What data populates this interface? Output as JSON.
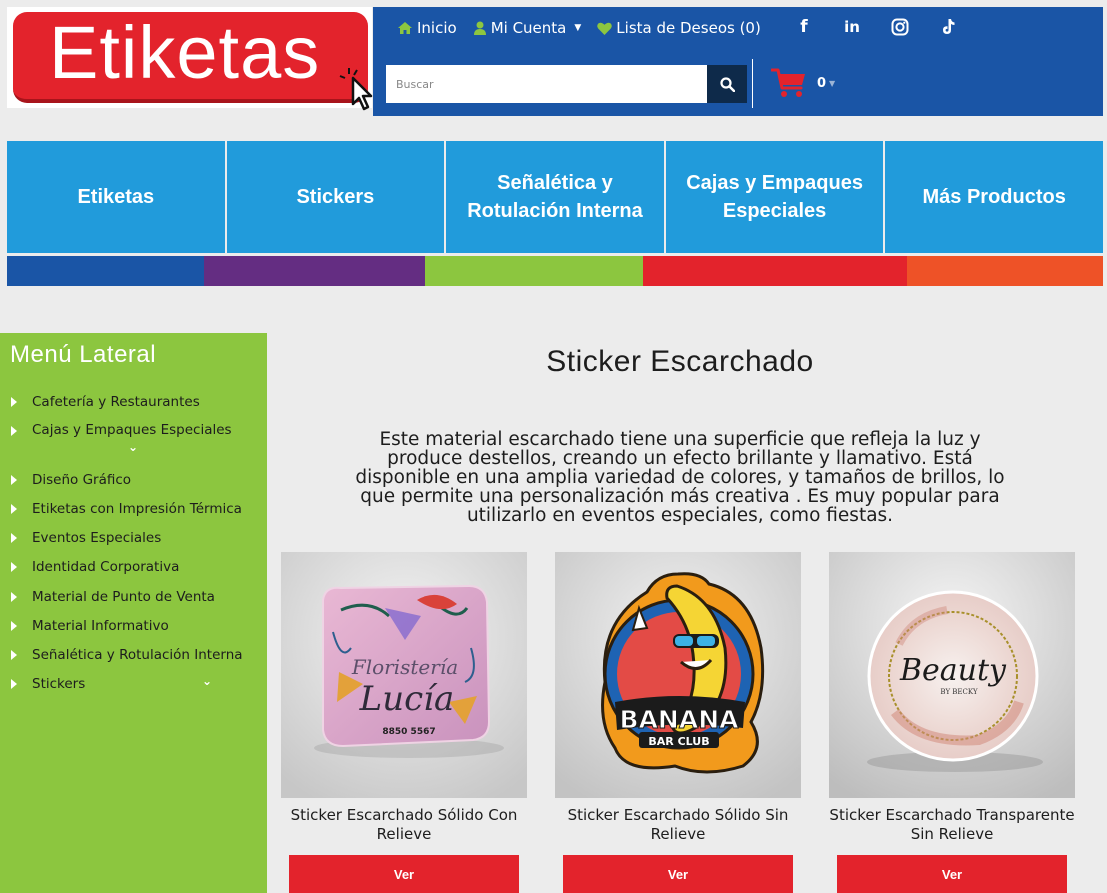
{
  "brand": {
    "logo_text": "Etiketas"
  },
  "header": {
    "links": [
      {
        "label": "Inicio",
        "icon": "home-icon"
      },
      {
        "label": "Mi Cuenta",
        "icon": "user-icon"
      },
      {
        "label": "Lista de Deseos (0)",
        "icon": "heart-icon"
      }
    ],
    "socials": [
      "facebook-icon",
      "linkedin-icon",
      "instagram-icon",
      "tiktok-icon"
    ],
    "search": {
      "placeholder": "Buscar"
    },
    "cart": {
      "count": "0"
    }
  },
  "nav": {
    "items": [
      {
        "label": "Etiketas"
      },
      {
        "label": "Stickers"
      },
      {
        "label": "Señalética y Rotulación Interna"
      },
      {
        "label": "Cajas y Empaques Especiales"
      },
      {
        "label": "Más Productos"
      }
    ],
    "strip_colors": [
      "#1a55a6",
      "#642d82",
      "#8cc63f",
      "#e3232c",
      "#ee5227"
    ]
  },
  "sidebar": {
    "title": "Menú Lateral",
    "items": [
      {
        "label": "Cafetería y Restaurantes"
      },
      {
        "label": "Cajas y Empaques Especiales"
      },
      {
        "label": "Diseño Gráfico"
      },
      {
        "label": "Etiketas con Impresión Térmica"
      },
      {
        "label": "Eventos Especiales"
      },
      {
        "label": "Identidad Corporativa"
      },
      {
        "label": "Material de Punto de Venta"
      },
      {
        "label": "Material Informativo"
      },
      {
        "label": "Señalética y Rotulación Interna"
      },
      {
        "label": "Stickers"
      }
    ]
  },
  "main": {
    "title": "Sticker Escarchado",
    "description": "Este material escarchado tiene una superficie que refleja la luz y produce destellos, creando un efecto brillante y llamativo. Está disponible en una amplia variedad de colores, y tamaños de brillos, lo que permite una personalización más creativa . Es muy popular para utilizarlo en eventos especiales, como fiestas.",
    "products": [
      {
        "name": "Sticker Escarchado Sólido Con Relieve",
        "button": "Ver",
        "img_text_1": "Floristería",
        "img_text_2": "Lucía",
        "img_text_3": "8850 5567"
      },
      {
        "name": "Sticker Escarchado Sólido Sin Relieve",
        "button": "Ver",
        "img_text_1": "BANANA",
        "img_text_2": "BAR CLUB"
      },
      {
        "name": "Sticker Escarchado Transparente Sin Relieve",
        "button": "Ver",
        "img_text_1": "Beauty",
        "img_text_2": "BY BECKY"
      }
    ]
  },
  "colors": {
    "header_blue": "#1a55a6",
    "nav_blue": "#219bdb",
    "sidebar_green": "#8cc63f",
    "accent_red": "#e3232c",
    "search_btn": "#0e2a4a"
  }
}
